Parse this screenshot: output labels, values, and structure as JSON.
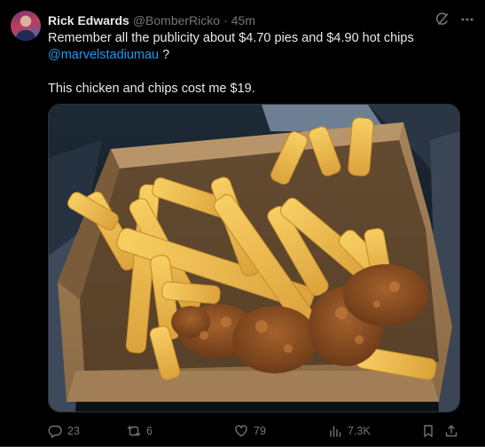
{
  "author": {
    "name": "Rick Edwards",
    "handle": "@BomberRicko",
    "separator": "·",
    "time": "45m"
  },
  "post": {
    "text_line1": "Remember all the publicity about $4.70 pies and $4.90 hot chips",
    "mention": "@marvelstadiumau",
    "mention_suffix": " ?",
    "text_line3": "This chicken and chips cost me $19."
  },
  "actions": {
    "replies": "23",
    "reposts": "6",
    "likes": "79",
    "views": "7.3K"
  },
  "icons": {
    "header": [
      "grok-icon",
      "more-icon"
    ],
    "actions": [
      "reply-icon",
      "repost-icon",
      "like-icon",
      "views-icon",
      "bookmark-icon",
      "share-icon"
    ]
  },
  "colors": {
    "background": "#000000",
    "text": "#e7e9ea",
    "muted": "#71767b",
    "link": "#1d9bf0",
    "border": "#2f3336"
  }
}
